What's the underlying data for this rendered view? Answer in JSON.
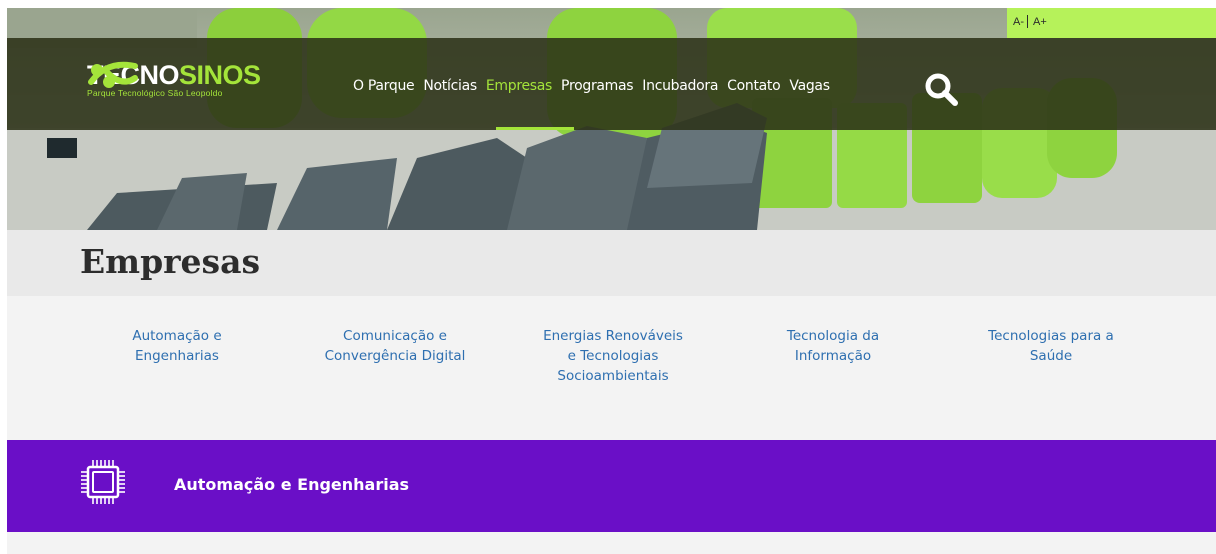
{
  "accessibility": {
    "font_decrease_label": "A-",
    "font_increase_label": "A+"
  },
  "header": {
    "logo": {
      "word_part1": "TECNO",
      "word_part2": "SINOS",
      "subtitle": "Parque Tecnológico São Leopoldo"
    },
    "nav_items": [
      {
        "label": "O Parque",
        "active": false
      },
      {
        "label": "Notícias",
        "active": false
      },
      {
        "label": "Empresas",
        "active": true
      },
      {
        "label": "Programas",
        "active": false
      },
      {
        "label": "Incubadora",
        "active": false
      },
      {
        "label": "Contato",
        "active": false
      },
      {
        "label": "Vagas",
        "active": false
      }
    ],
    "search_icon": "search-icon"
  },
  "page": {
    "title": "Empresas"
  },
  "categories": [
    {
      "line1": "Automação e",
      "line2": "Engenharias",
      "line3": ""
    },
    {
      "line1": "Comunicação e",
      "line2": "Convergência Digital",
      "line3": ""
    },
    {
      "line1": "Energias Renováveis",
      "line2": "e Tecnologias",
      "line3": "Socioambientais"
    },
    {
      "line1": "Tecnologia da",
      "line2": "Informação",
      "line3": ""
    },
    {
      "line1": "Tecnologias para a",
      "line2": "Saúde",
      "line3": ""
    }
  ],
  "section": {
    "title": "Automação e Engenharias",
    "icon": "chip-icon"
  },
  "colors": {
    "accent_green": "#a4e43a",
    "link_blue": "#2e6fb0",
    "section_purple": "#6a0fc7",
    "navbar_dark": "#2c3218"
  }
}
